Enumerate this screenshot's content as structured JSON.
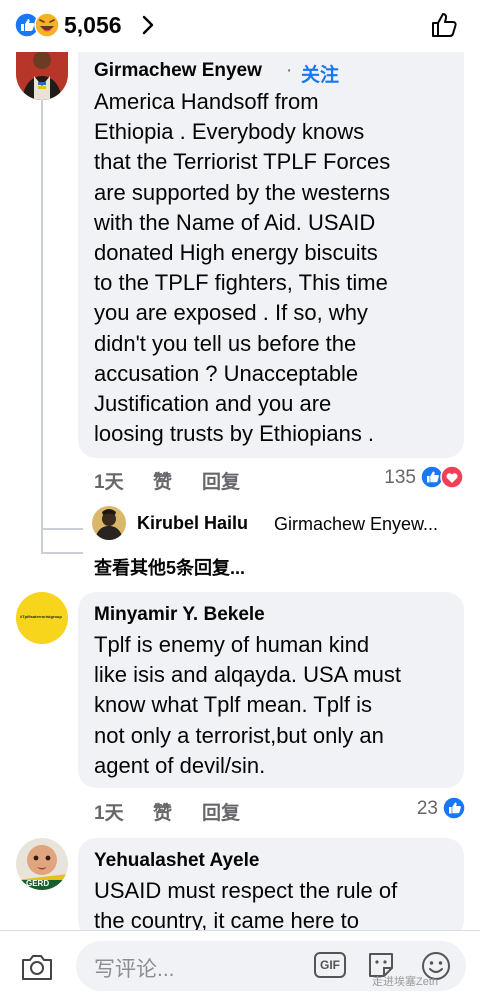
{
  "header": {
    "reaction_count": "5,056",
    "reactions": [
      "like-reaction",
      "haha-reaction"
    ]
  },
  "comments": [
    {
      "name": "Girmachew Enyew",
      "follow_label": "关注",
      "dot": "·",
      "text_lines": [
        "America Handsoff from",
        "Ethiopia . Everybody knows",
        "that the Terriorist TPLF Forces",
        "are supported by the westerns",
        "with the Name of Aid. USAID",
        "donated High energy biscuits",
        "to the TPLF fighters, This time",
        "you are exposed .  If so, why",
        "didn't you tell us before the",
        "accusation ? Unacceptable",
        "Justification and you are",
        "loosing trusts by Ethiopians ."
      ],
      "time": "1天",
      "like_label": "赞",
      "reply_label": "回复",
      "reaction_count": "135",
      "reactions": [
        "like-reaction",
        "love-reaction"
      ],
      "reply_preview": {
        "name": "Kirubel Hailu",
        "text": "Girmachew Enyew..."
      },
      "view_more_replies": "查看其他5条回复..."
    },
    {
      "name": "Minyamir Y. Bekele",
      "avatar_text": "#Tplfisaterroristgroup",
      "text_lines": [
        "Tplf is enemy of human kind",
        "like isis and alqayda. USA must",
        "know what Tplf mean. Tplf is",
        "not only a terrorist,but only an",
        "agent of devil/sin."
      ],
      "time": "1天",
      "like_label": "赞",
      "reply_label": "回复",
      "reaction_count": "23",
      "reactions": [
        "like-reaction"
      ]
    },
    {
      "name": "Yehualashet Ayele",
      "avatar_badge": "GERD",
      "text_lines": [
        "USAID must respect  the rule of",
        "the country, it came here to"
      ]
    }
  ],
  "composer": {
    "placeholder": "写评论...",
    "gif_label": "GIF"
  },
  "watermark": "走进埃塞Zeth",
  "colors": {
    "facebook_blue": "#1877f2",
    "bubble_bg": "#f0f2f5",
    "secondary_text": "#65676b",
    "love_red": "#f33e58",
    "haha_yellow": "#f7b125",
    "avatar_yellow": "#f7d51d"
  }
}
